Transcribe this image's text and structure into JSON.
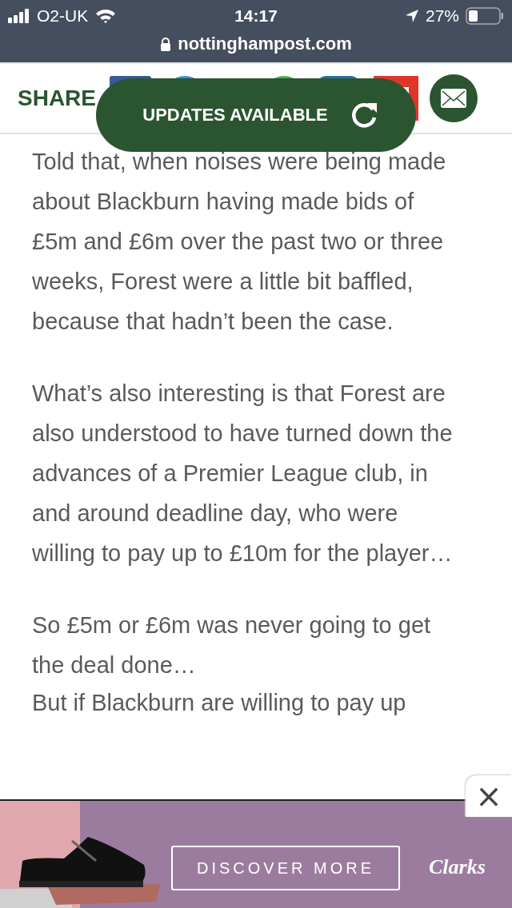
{
  "status_bar": {
    "carrier": "O2-UK",
    "time": "14:17",
    "battery": "27%"
  },
  "address_bar": {
    "url": "nottinghampost.com"
  },
  "share_bar": {
    "label": "SHARE"
  },
  "updates_pill": {
    "label": "UPDATES AVAILABLE"
  },
  "article": {
    "paragraphs": [
      "Told that, when noises were being made about Blackburn having made bids of £5m and £6m over the past two or three weeks, Forest were a little bit baffled, because that hadn’t been the case.",
      "What’s also interesting is that Forest are also understood to have turned down the advances of a Premier League club, in and around deadline day, who were willing to pay up to £10m for the player…",
      "So £5m or £6m was never going to get the deal done…",
      "But if Blackburn are willing to pay up"
    ]
  },
  "ad": {
    "close": "×",
    "button": "DISCOVER MORE",
    "brand": "Clarks"
  }
}
